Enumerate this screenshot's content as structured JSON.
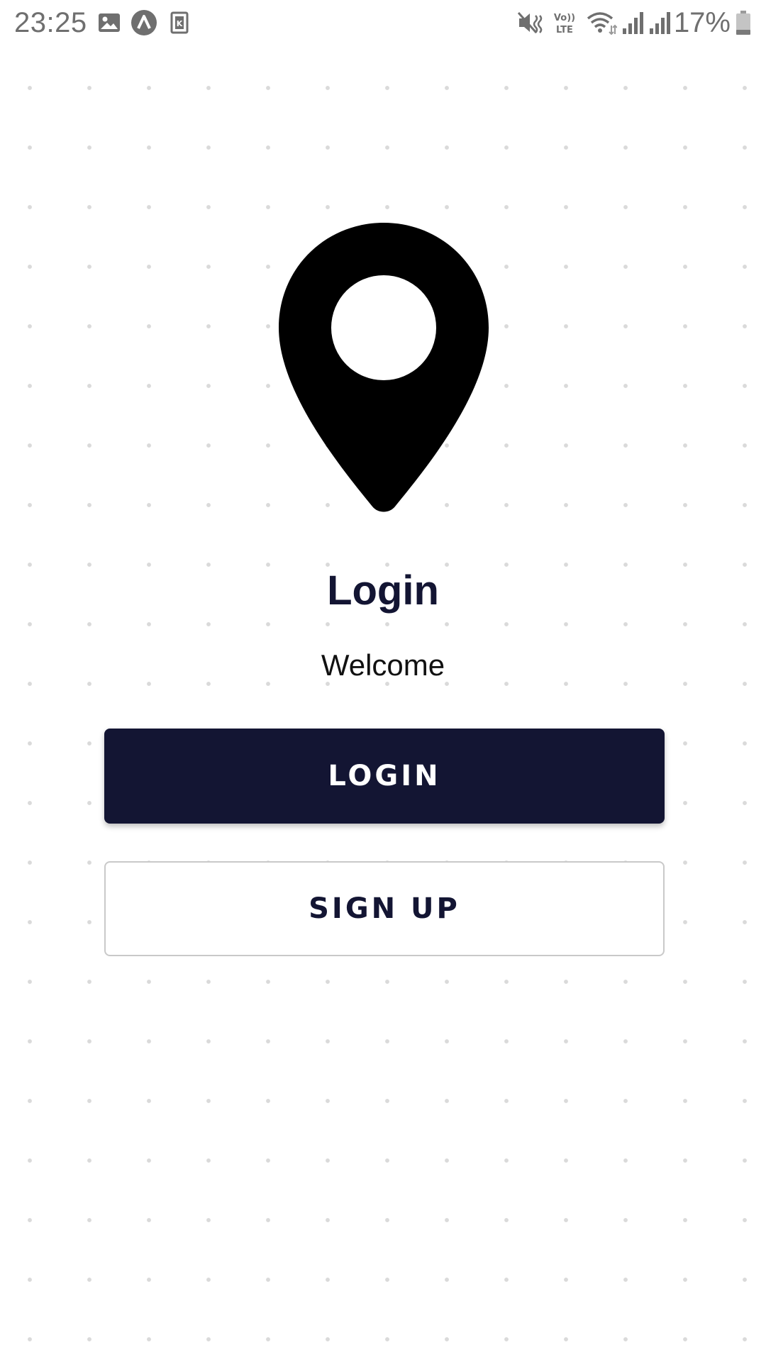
{
  "status_bar": {
    "time": "23:25",
    "battery": "17%",
    "icons": [
      "image-icon",
      "app-a-icon",
      "app-k-icon",
      "mute-icon",
      "volte-lte-icon",
      "wifi-icon",
      "signal-icon",
      "signal-icon",
      "battery-icon"
    ]
  },
  "login_screen": {
    "title": "Login",
    "subtitle": "Welcome",
    "login_button": "LOGIN",
    "signup_button": "SIGN UP"
  },
  "colors": {
    "primary": "#131533",
    "background": "#ffffff",
    "dot_grid": "#dadada"
  }
}
